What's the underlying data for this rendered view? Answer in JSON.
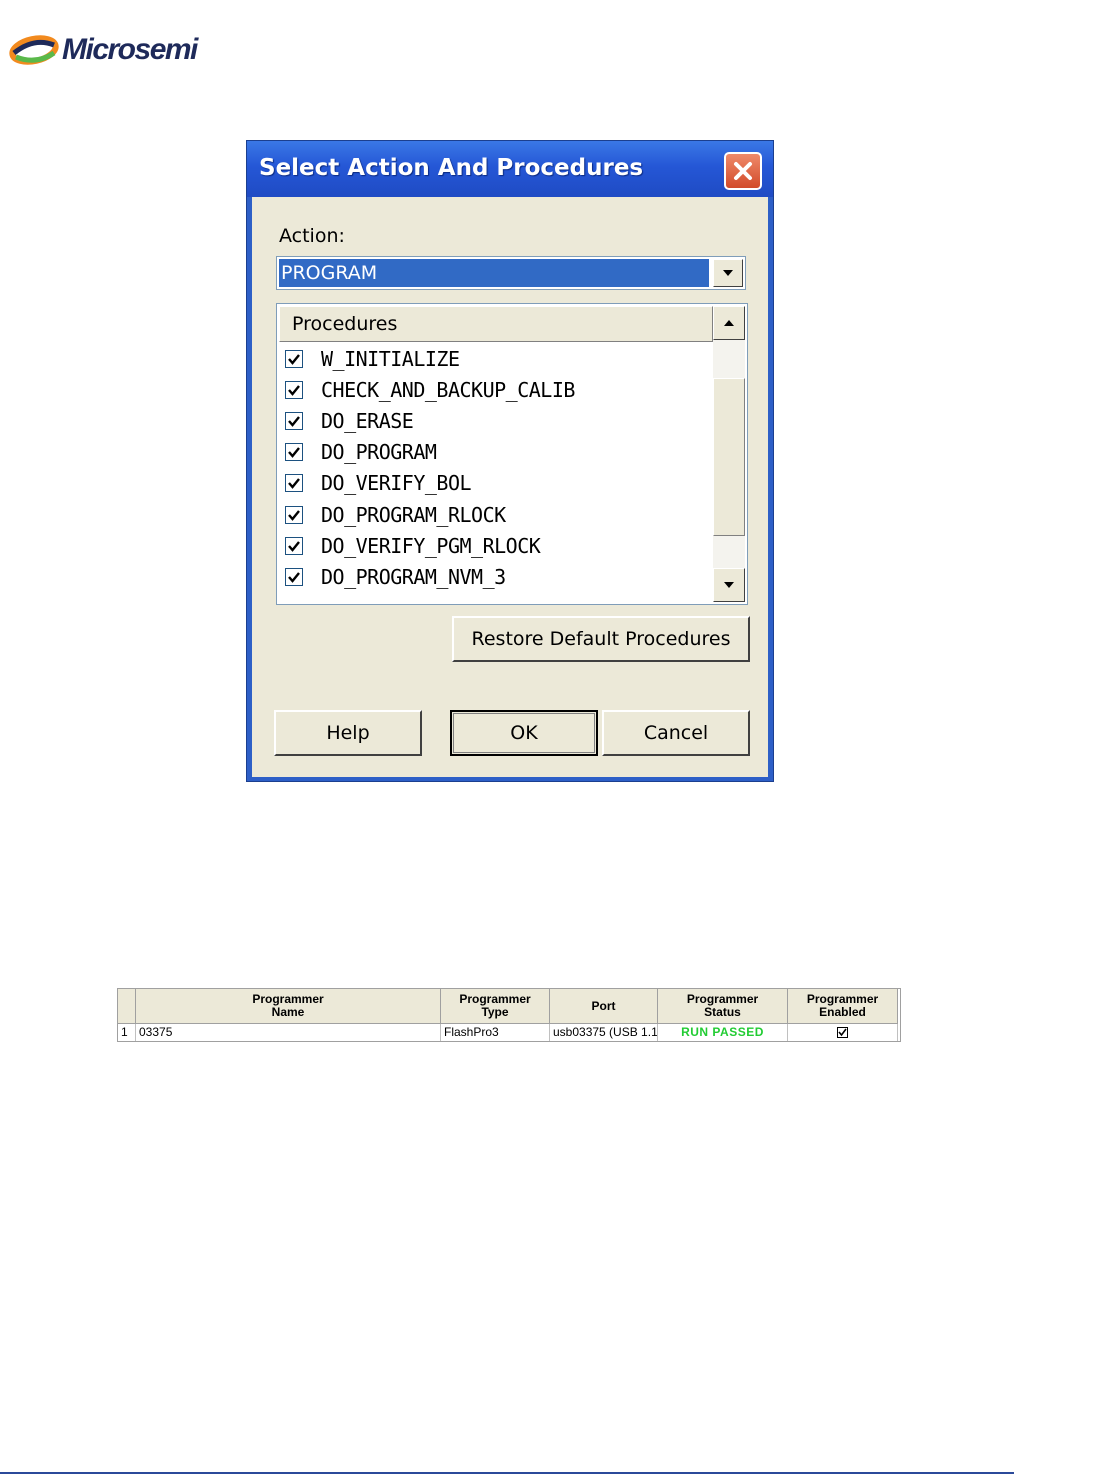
{
  "logo": {
    "text": "Microsemi",
    "reg": "."
  },
  "dialog": {
    "title": "Select Action And Procedures",
    "action_label": "Action:",
    "action_value": "PROGRAM",
    "procedures_header": "Procedures",
    "procedures": [
      {
        "label": "W_INITIALIZE",
        "checked": true
      },
      {
        "label": "CHECK_AND_BACKUP_CALIB",
        "checked": true
      },
      {
        "label": "DO_ERASE",
        "checked": true
      },
      {
        "label": "DO_PROGRAM",
        "checked": true
      },
      {
        "label": "DO_VERIFY_BOL",
        "checked": true
      },
      {
        "label": "DO_PROGRAM_RLOCK",
        "checked": true
      },
      {
        "label": "DO_VERIFY_PGM_RLOCK",
        "checked": true
      },
      {
        "label": "DO_PROGRAM_NVM_3",
        "checked": true
      }
    ],
    "restore_button": "Restore Default Procedures",
    "help_button": "Help",
    "ok_button": "OK",
    "cancel_button": "Cancel"
  },
  "programmer_grid": {
    "headers": {
      "name": "Programmer\nName",
      "type": "Programmer\nType",
      "port": "Port",
      "status": "Programmer\nStatus",
      "enabled": "Programmer\nEnabled"
    },
    "rows": [
      {
        "index": "1",
        "name": "03375",
        "type": "FlashPro3",
        "port": "usb03375 (USB 1.1)",
        "status": "RUN PASSED",
        "enabled": true
      }
    ],
    "status_color": "#22cc33"
  }
}
